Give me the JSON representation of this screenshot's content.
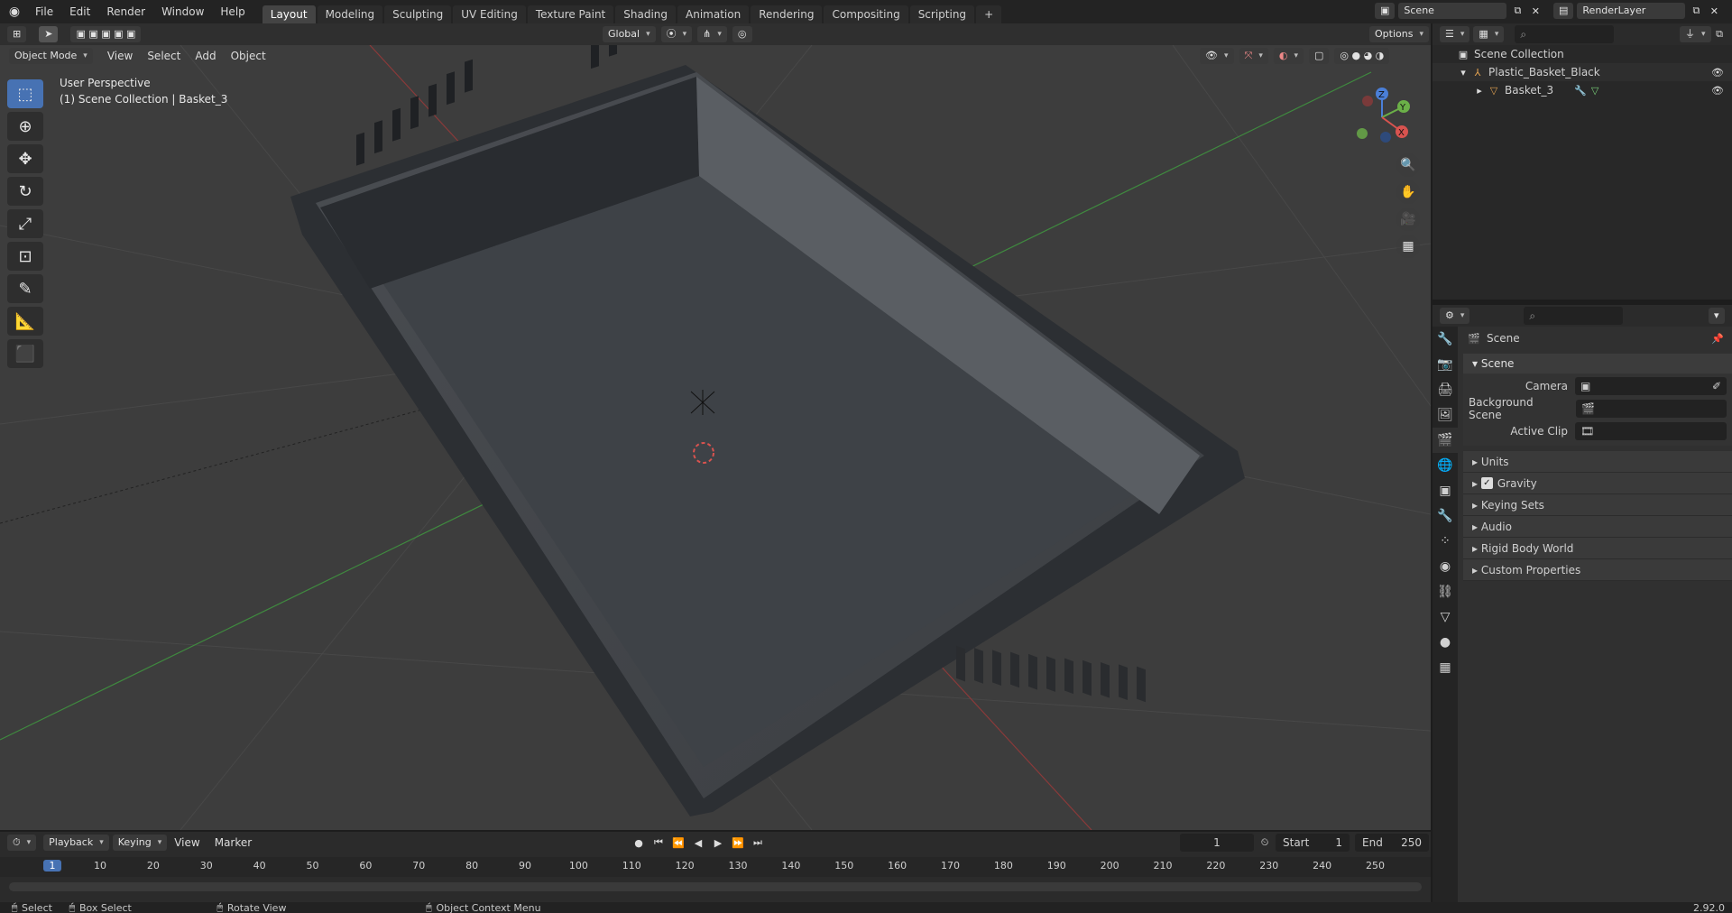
{
  "topbar": {
    "menus": [
      "File",
      "Edit",
      "Render",
      "Window",
      "Help"
    ],
    "workspaces": [
      "Layout",
      "Modeling",
      "Sculpting",
      "UV Editing",
      "Texture Paint",
      "Shading",
      "Animation",
      "Rendering",
      "Compositing",
      "Scripting"
    ],
    "active_workspace": "Layout",
    "add_tab": "+",
    "scene_label": "Scene",
    "layer_label": "RenderLayer"
  },
  "viewport_header": {
    "mode": "Object Mode",
    "menus": [
      "View",
      "Select",
      "Add",
      "Object"
    ],
    "transform_orientation": "Global",
    "options_label": "Options"
  },
  "viewport": {
    "perspective": "User Perspective",
    "collection_info": "(1) Scene Collection | Basket_3",
    "tools": [
      "select-box-icon",
      "cursor-icon",
      "move-icon",
      "rotate-icon",
      "scale-icon",
      "transform-icon",
      "annotate-icon",
      "measure-icon",
      "add-cube-icon"
    ],
    "nav_buttons": [
      "zoom-icon",
      "pan-hand-icon",
      "camera-icon",
      "grid-ortho-icon"
    ],
    "gizmo_axes": [
      "X",
      "Y",
      "Z"
    ]
  },
  "outliner": {
    "root": "Scene Collection",
    "items": [
      {
        "label": "Plastic_Basket_Black",
        "indent": 1
      },
      {
        "label": "Basket_3",
        "indent": 2
      }
    ]
  },
  "properties": {
    "context_title": "Scene",
    "panel_title": "Scene",
    "fields": [
      {
        "label": "Camera"
      },
      {
        "label": "Background Scene"
      },
      {
        "label": "Active Clip"
      }
    ],
    "subpanels": [
      "Units",
      "Gravity",
      "Keying Sets",
      "Audio",
      "Rigid Body World",
      "Custom Properties"
    ],
    "gravity_checked": true
  },
  "timeline": {
    "menus": [
      "Playback",
      "Keying",
      "View",
      "Marker"
    ],
    "current_frame": "1",
    "start_label": "Start",
    "start_value": "1",
    "end_label": "End",
    "end_value": "250",
    "ticks": [
      "1",
      "10",
      "20",
      "30",
      "40",
      "50",
      "60",
      "70",
      "80",
      "90",
      "100",
      "110",
      "120",
      "130",
      "140",
      "150",
      "160",
      "170",
      "180",
      "190",
      "200",
      "210",
      "220",
      "230",
      "240",
      "250"
    ]
  },
  "statusbar": {
    "items": [
      "Select",
      "Box Select",
      "Rotate View",
      "Object Context Menu"
    ],
    "version": "2.92.0"
  }
}
